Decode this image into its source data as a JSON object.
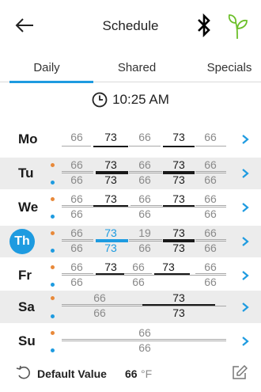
{
  "header": {
    "title": "Schedule",
    "back_icon": "arrow-left-icon",
    "bluetooth_icon": "bluetooth-icon",
    "eco_icon": "leaf-sprout-icon"
  },
  "tabs": [
    {
      "label": "Daily",
      "active": true
    },
    {
      "label": "Shared",
      "active": false
    },
    {
      "label": "Specials",
      "active": false
    }
  ],
  "current_time": "10:25 AM",
  "colors": {
    "accent": "#1e9be0",
    "orange": "#e8893a",
    "shaded_row": "#ececec"
  },
  "days": [
    {
      "label": "Mo",
      "values": [
        "66",
        "73",
        "66",
        "73",
        "66"
      ]
    },
    {
      "label": "Tu",
      "top": [
        "66",
        "73",
        "66",
        "73",
        "66"
      ],
      "bottom": [
        "66",
        "73",
        "66",
        "73",
        "66"
      ]
    },
    {
      "label": "We",
      "top": [
        "66",
        "73",
        "66",
        "73",
        "66"
      ],
      "bottom": [
        "66",
        "66",
        "66"
      ]
    },
    {
      "label": "Th",
      "today": true,
      "top": [
        "66",
        "73",
        "19",
        "73",
        "66"
      ],
      "bottom": [
        "66",
        "73",
        "66",
        "73",
        "66"
      ]
    },
    {
      "label": "Fr",
      "top": [
        "66",
        "73",
        "66",
        "73",
        "66"
      ],
      "bottom": [
        "66",
        "66",
        "66"
      ]
    },
    {
      "label": "Sa",
      "top": [
        "66",
        "73"
      ],
      "bottom": [
        "66",
        "73"
      ]
    },
    {
      "label": "Su",
      "top": [
        "66"
      ],
      "bottom": [
        "66"
      ]
    }
  ],
  "footer": {
    "label": "Default Value",
    "value": "66",
    "unit": "°F"
  }
}
